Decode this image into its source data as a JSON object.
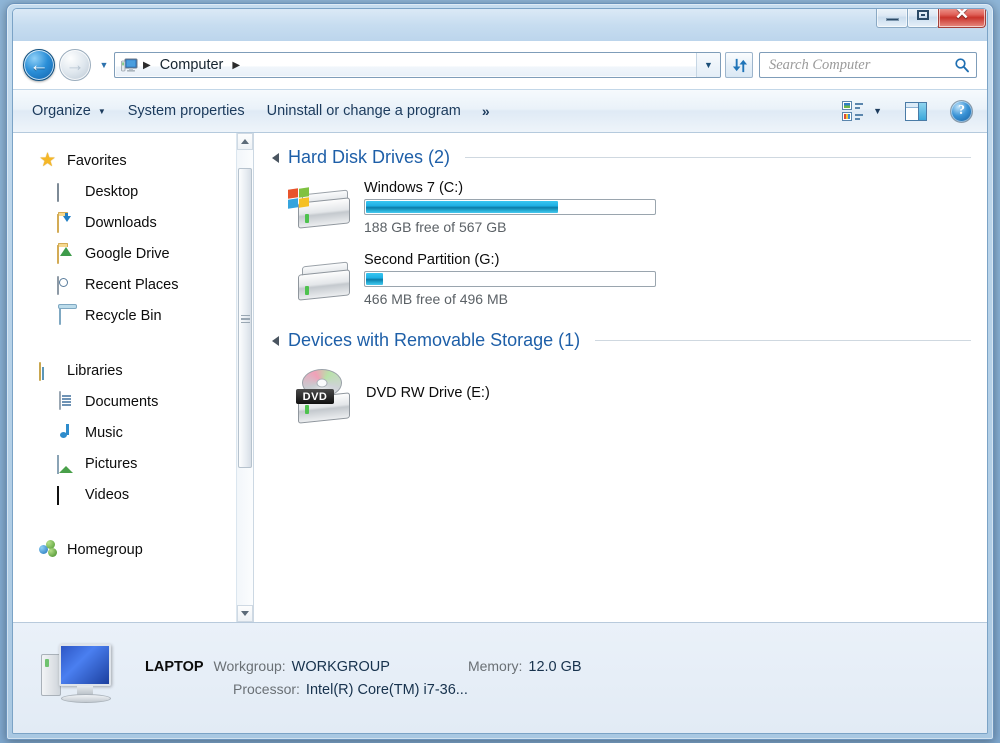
{
  "window": {
    "controls": {
      "minimize": "minimize-button",
      "restore": "restore-button",
      "close_glyph": "✕"
    }
  },
  "addressbar": {
    "back_glyph": "←",
    "forward_glyph": "→",
    "history_caret": "▼",
    "computer_icon": "computer-icon",
    "crumb_sep": "▶",
    "path": "Computer",
    "dropdown_caret": "▼",
    "refresh_label": "refresh-icon"
  },
  "search": {
    "placeholder": "Search Computer",
    "icon": "search-icon"
  },
  "toolbar": {
    "organize": "Organize",
    "organize_caret": "▼",
    "system_properties": "System properties",
    "uninstall": "Uninstall or change a program",
    "overflow": "»",
    "view_caret": "▼",
    "view_icon": "change-view-icon",
    "preview_icon": "preview-pane-icon",
    "help_glyph": "?"
  },
  "sidebar": {
    "groups": [
      {
        "label": "Favorites",
        "icon": "star-icon",
        "items": [
          {
            "label": "Desktop",
            "icon": "desktop-icon"
          },
          {
            "label": "Downloads",
            "icon": "downloads-folder-icon"
          },
          {
            "label": "Google Drive",
            "icon": "google-drive-icon"
          },
          {
            "label": "Recent Places",
            "icon": "recent-places-icon"
          },
          {
            "label": "Recycle Bin",
            "icon": "recycle-bin-icon"
          }
        ]
      },
      {
        "label": "Libraries",
        "icon": "libraries-icon",
        "items": [
          {
            "label": "Documents",
            "icon": "documents-icon"
          },
          {
            "label": "Music",
            "icon": "music-note-icon"
          },
          {
            "label": "Pictures",
            "icon": "pictures-icon"
          },
          {
            "label": "Videos",
            "icon": "videos-filmstrip-icon"
          }
        ]
      },
      {
        "label": "Homegroup",
        "icon": "homegroup-icon",
        "items": []
      }
    ]
  },
  "content": {
    "sections": [
      {
        "title": "Hard Disk Drives (2)",
        "drives": [
          {
            "name": "Windows 7 (C:)",
            "free_text": "188 GB free of 567 GB",
            "free": "188 GB",
            "total": "567 GB",
            "used_percent": 66.8,
            "icon": "hard-drive-windows-icon"
          },
          {
            "name": "Second Partition (G:)",
            "free_text": "466 MB free of 496 MB",
            "free": "466 MB",
            "total": "496 MB",
            "used_percent": 6.0,
            "icon": "hard-drive-icon"
          }
        ]
      },
      {
        "title": "Devices with Removable Storage (1)",
        "drives": [
          {
            "name": "DVD RW Drive (E:)",
            "icon": "dvd-drive-icon",
            "badge": "DVD"
          }
        ]
      }
    ]
  },
  "statusbar": {
    "icon": "computer-large-icon",
    "pc_name": "LAPTOP",
    "workgroup_label": "Workgroup:",
    "workgroup_value": "WORKGROUP",
    "memory_label": "Memory:",
    "memory_value": "12.0 GB",
    "processor_label": "Processor:",
    "processor_value": "Intel(R) Core(TM) i7-36..."
  },
  "colors": {
    "accent_blue": "#1e5fa8",
    "bar_fill": "#1fb0e4",
    "close_red": "#c9342b",
    "star_gold": "#f5b726"
  }
}
